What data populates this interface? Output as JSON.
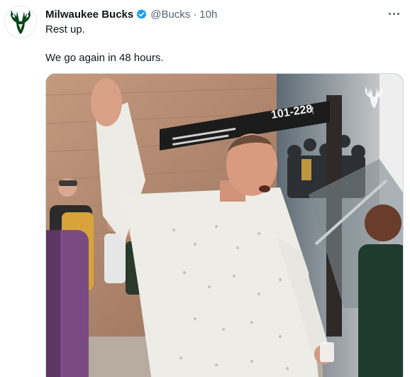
{
  "tweet": {
    "display_name": "Milwaukee Bucks",
    "handle": "@Bucks",
    "separator": "·",
    "time": "10h",
    "lines": [
      "Rest up.",
      "We go again in 48 hours."
    ]
  },
  "media": {
    "sign_section": "101-228",
    "sign_arrow": "↑"
  },
  "icons": {
    "avatar": "bucks-logo-icon",
    "verified": "verified-badge-icon",
    "more": "more-options-icon",
    "watermark": "bucks-logo-icon"
  },
  "colors": {
    "bucks_green": "#00471b",
    "bucks_cream": "#eee1c6",
    "verified_blue": "#1d9bf0"
  }
}
